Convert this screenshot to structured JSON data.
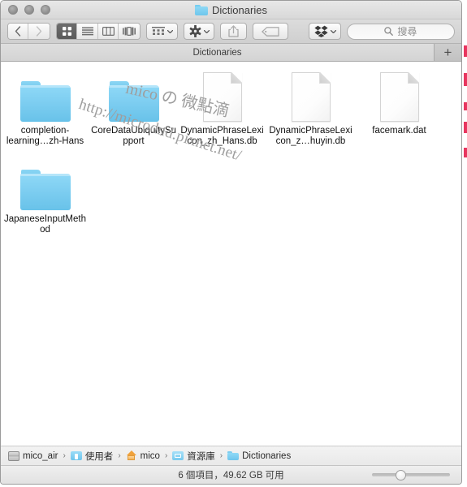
{
  "window": {
    "title": "Dictionaries",
    "title_icon": "folder-icon",
    "traffic_lights": [
      "close-button",
      "minimize-button",
      "zoom-button"
    ]
  },
  "toolbar": {
    "nav": {
      "back_icon": "chevron-left-icon",
      "back_label": "‹",
      "forward_icon": "chevron-right-icon",
      "forward_label": "›"
    },
    "view_modes": [
      {
        "name": "icon-view",
        "icon": "grid-icon",
        "selected": true
      },
      {
        "name": "list-view",
        "icon": "list-icon",
        "selected": false
      },
      {
        "name": "column-view",
        "icon": "columns-icon",
        "selected": false
      },
      {
        "name": "cover-flow-view",
        "icon": "coverflow-icon",
        "selected": false
      }
    ],
    "arrange_button": {
      "name": "arrange-by-button",
      "icon": "arrange-icon"
    },
    "action_button": {
      "name": "action-button",
      "icon": "gear-icon"
    },
    "share_button": {
      "name": "share-button",
      "icon": "share-icon",
      "disabled": true
    },
    "tag_button": {
      "name": "edit-tags-button",
      "icon": "tag-icon",
      "disabled": true
    },
    "dropbox_button": {
      "name": "dropbox-button",
      "icon": "dropbox-icon"
    }
  },
  "search": {
    "placeholder": "搜尋",
    "value": "",
    "icon": "search-icon"
  },
  "tabs": {
    "active_label": "Dictionaries",
    "new_tab_label": "+"
  },
  "files": [
    {
      "name": "completion-learning…zh-Hans",
      "type": "folder"
    },
    {
      "name": "CoreDataUbiquitySupport",
      "type": "folder"
    },
    {
      "name": "DynamicPhraseLexicon_zh_Hans.db",
      "type": "document"
    },
    {
      "name": "DynamicPhraseLexicon_z…huyin.db",
      "type": "document"
    },
    {
      "name": "facemark.dat",
      "type": "document"
    },
    {
      "name": "JapaneseInputMethod",
      "type": "folder"
    }
  ],
  "watermark": {
    "url": "http://microdnd.pixnet.net/",
    "brand": "mico の 微點滴"
  },
  "path_bar": [
    {
      "label": "mico_air",
      "icon": "hard-disk-icon"
    },
    {
      "label": "使用者",
      "icon": "users-folder-icon"
    },
    {
      "label": "mico",
      "icon": "home-folder-icon"
    },
    {
      "label": "資源庫",
      "icon": "library-folder-icon"
    },
    {
      "label": "Dictionaries",
      "icon": "folder-icon"
    }
  ],
  "path_separator": "›",
  "status": {
    "text": "6 個項目，49.62 GB 可用",
    "zoom_slider_percent": 35
  },
  "colors": {
    "folder_blue": "#7ecef1",
    "toolbar_gray": "#d4d4d4",
    "selected_view_mode": "#5b5b5b",
    "edge_artifact": "#e8365f"
  }
}
